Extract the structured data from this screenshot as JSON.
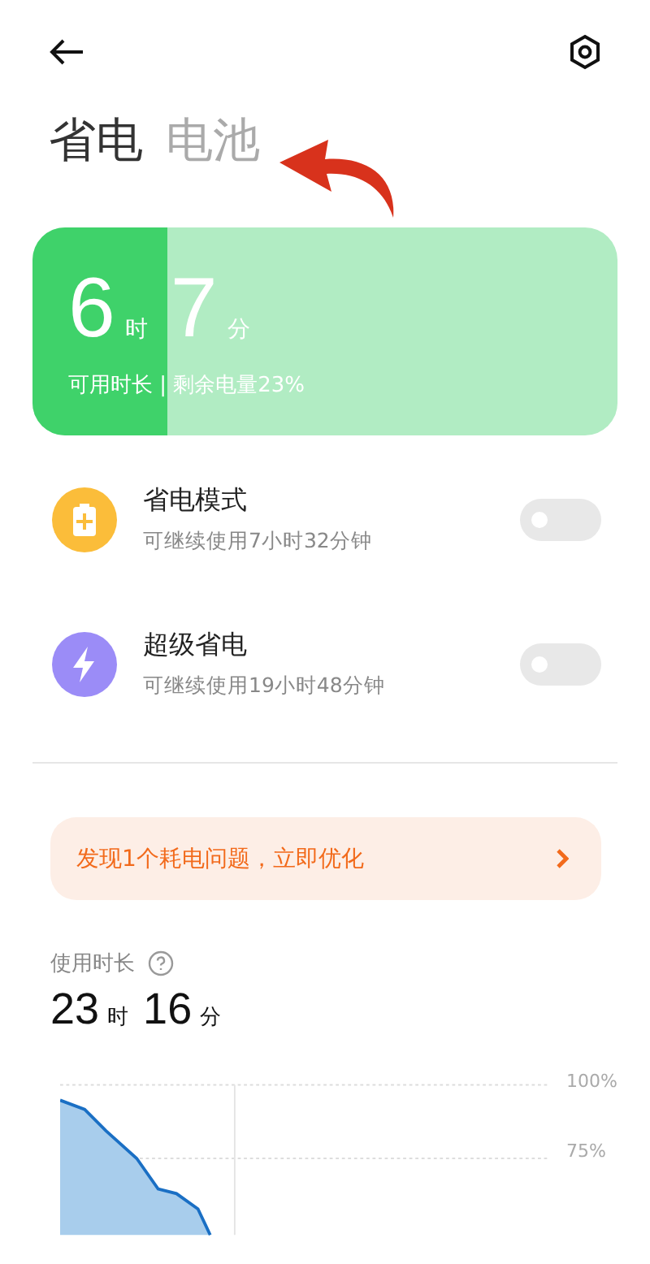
{
  "header": {
    "tabs": [
      {
        "label": "省电",
        "selected": true
      },
      {
        "label": "电池",
        "selected": false
      }
    ]
  },
  "battery_card": {
    "hours": "6",
    "hours_unit": "时",
    "minutes": "7",
    "minutes_unit": "分",
    "caption": "可用时长 | 剩余电量23%",
    "level": 0.23
  },
  "modes": [
    {
      "title": "省电模式",
      "subtitle": "可继续使用7小时32分钟",
      "kind": "battery",
      "on": false
    },
    {
      "title": "超级省电",
      "subtitle": "可继续使用19小时48分钟",
      "kind": "bolt",
      "on": false
    }
  ],
  "banner": {
    "text": "发现1个耗电问题，立即优化"
  },
  "usage": {
    "label": "使用时长",
    "hours": "23",
    "hours_unit": "时",
    "minutes": "16",
    "minutes_unit": "分"
  },
  "chart": {
    "y_labels": [
      "100%",
      "75%"
    ]
  }
}
